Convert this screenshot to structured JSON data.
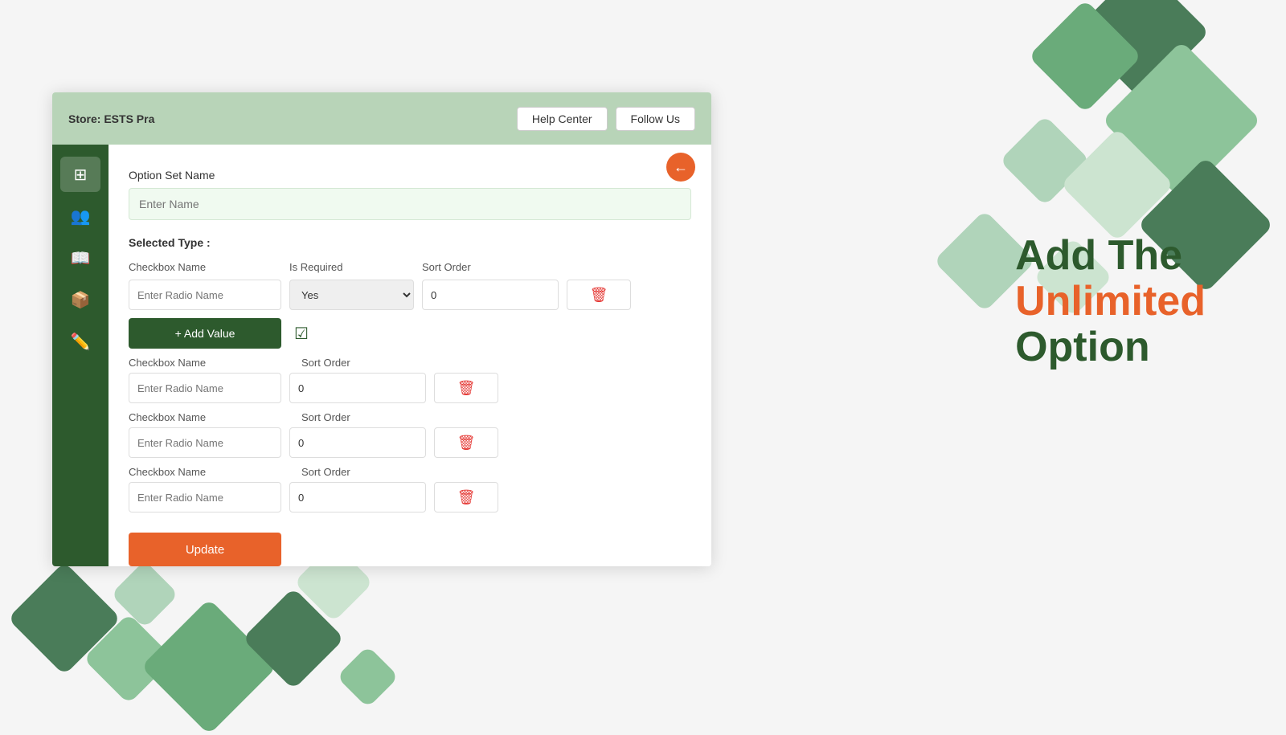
{
  "header": {
    "store_label": "Store:",
    "store_name": "ESTS Pra",
    "help_center_label": "Help Center",
    "follow_us_label": "Follow Us"
  },
  "sidebar": {
    "items": [
      {
        "icon": "⊞",
        "name": "dashboard-icon",
        "active": true
      },
      {
        "icon": "👥",
        "name": "users-icon",
        "active": false
      },
      {
        "icon": "📖",
        "name": "catalog-icon",
        "active": false
      },
      {
        "icon": "📦",
        "name": "products-icon",
        "active": false
      },
      {
        "icon": "✏️",
        "name": "edit-icon",
        "active": false
      }
    ]
  },
  "form": {
    "option_set_name_label": "Option Set Name",
    "option_set_placeholder": "Enter Name",
    "selected_type_label": "Selected Type :",
    "checkbox_name_label": "Checkbox Name",
    "is_required_label": "Is Required",
    "sort_order_label": "Sort Order",
    "enter_radio_placeholder": "Enter Radio Name",
    "yes_option": "Yes",
    "sort_order_default": "0",
    "add_value_label": "+ Add Value",
    "update_label": "Update",
    "checkbox_rows": [
      {
        "label": "Checkbox Name",
        "sort_label": "Sort Order",
        "placeholder": "Enter Radio Name",
        "value": "0"
      },
      {
        "label": "Checkbox Name",
        "sort_label": "Sort Order",
        "placeholder": "Enter Radio Name",
        "value": "0"
      },
      {
        "label": "Checkbox Name",
        "sort_label": "Sort Order",
        "placeholder": "Enter Radio Name",
        "value": "0"
      }
    ]
  },
  "promo": {
    "line1": "Add The",
    "line2": "Unlimited",
    "line3": "Option"
  },
  "back_icon": "←"
}
